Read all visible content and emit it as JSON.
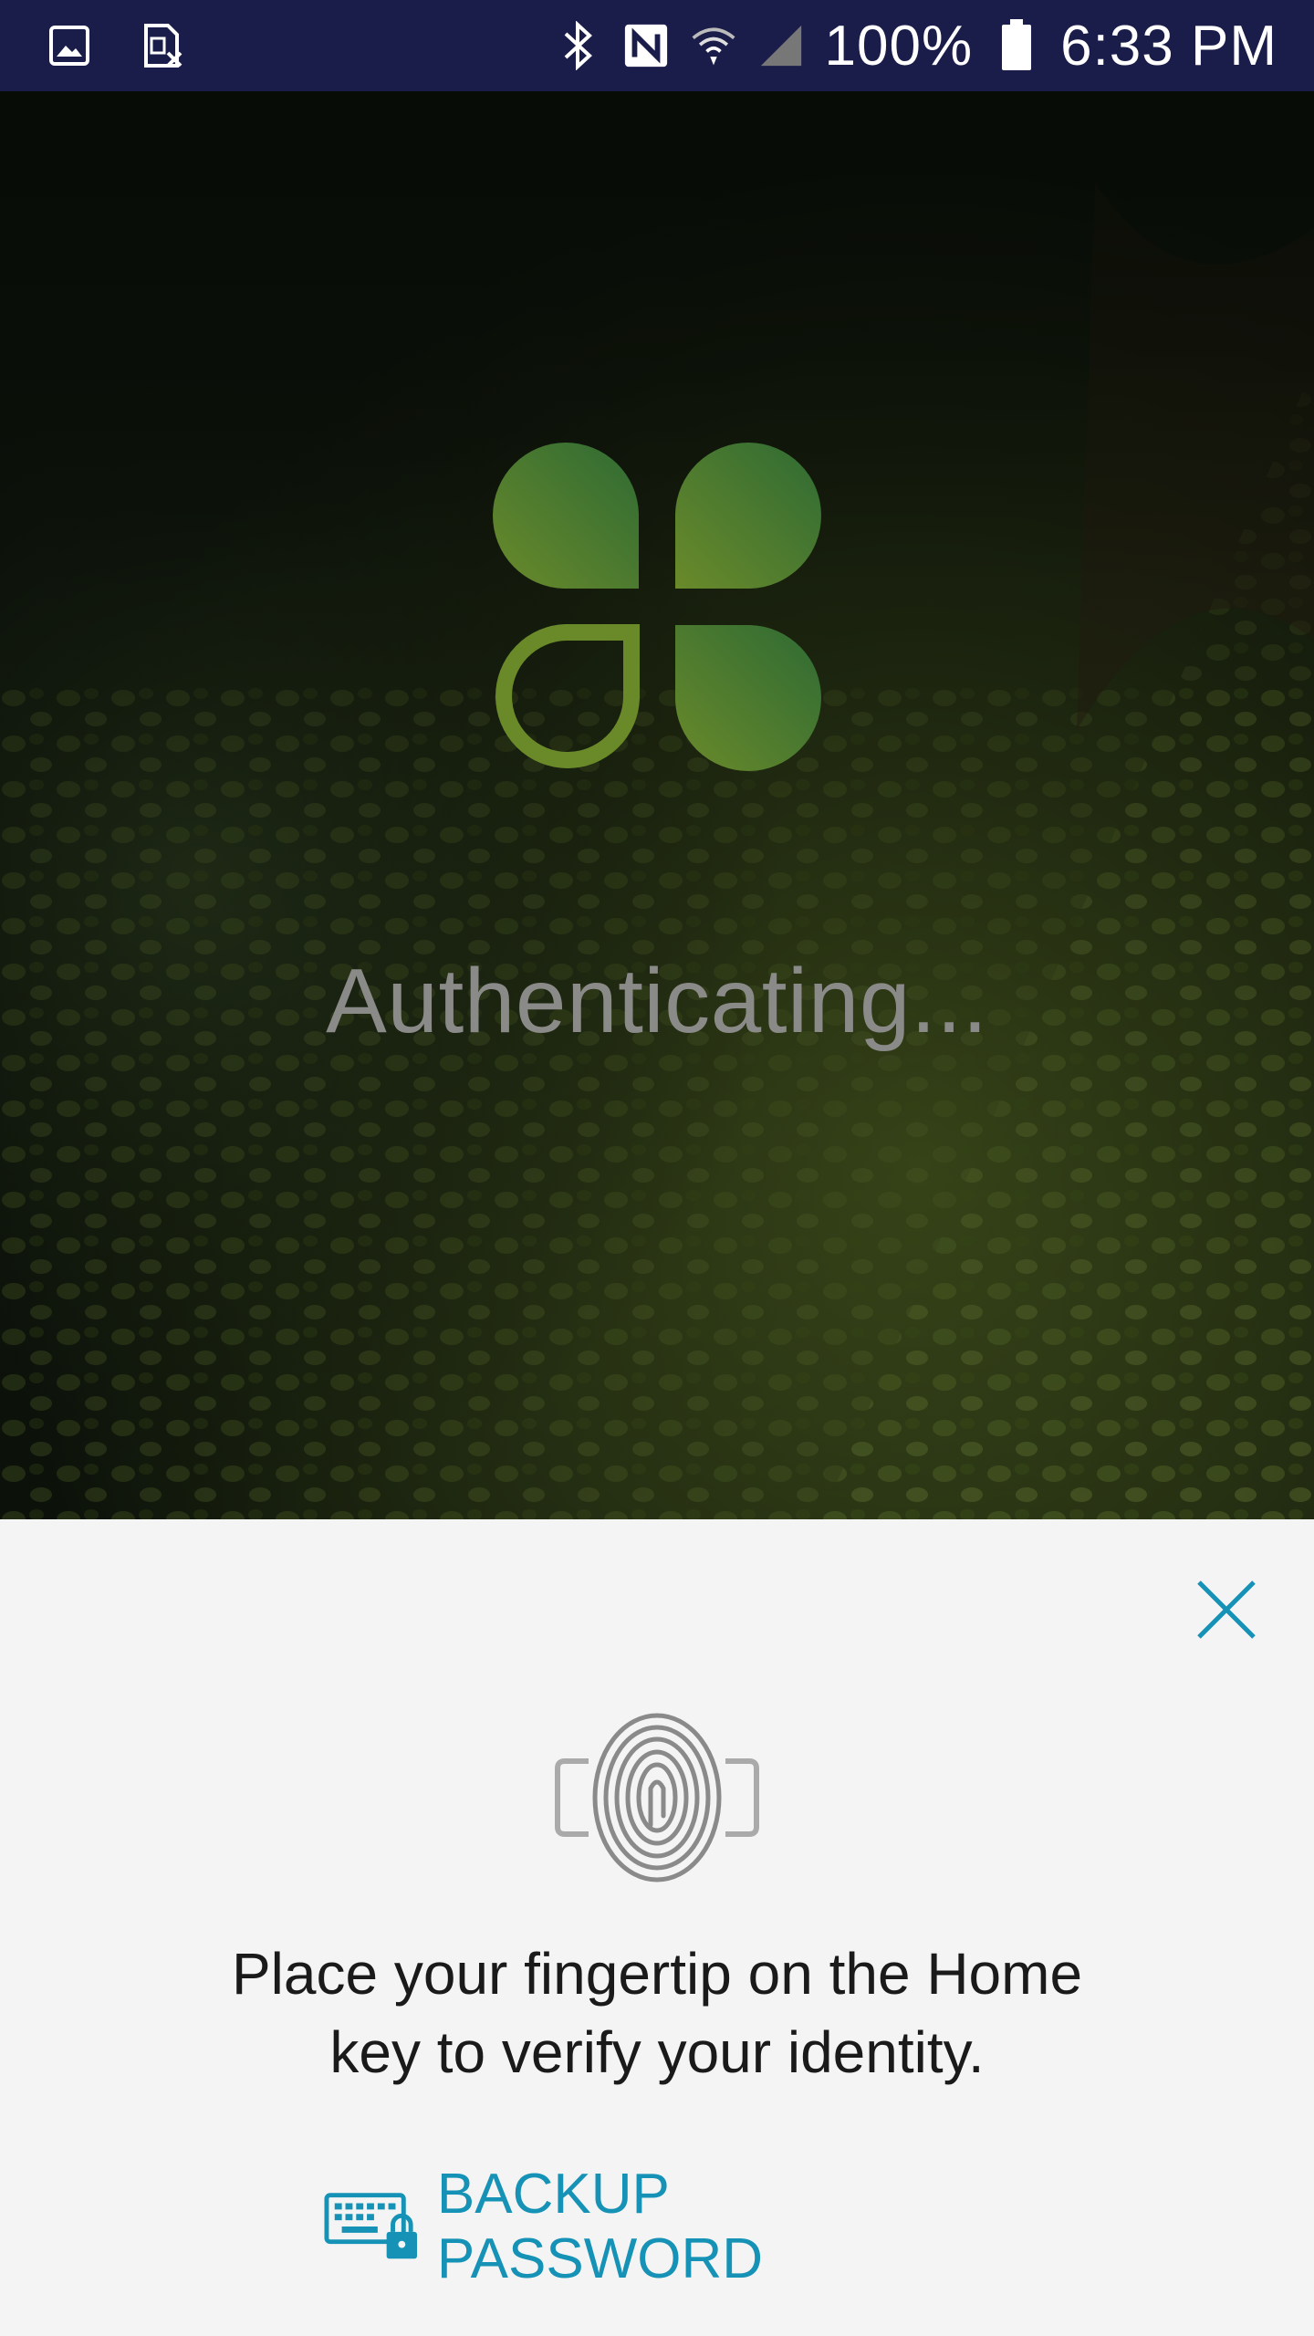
{
  "status_bar": {
    "battery": "100%",
    "time": "6:33 PM",
    "icons_left": [
      "gallery-icon",
      "sim-card-error-icon"
    ],
    "icons_right": [
      "bluetooth-icon",
      "nfc-icon",
      "wifi-icon",
      "signal-icon",
      "battery-icon"
    ],
    "background_color": "#1a1c4a"
  },
  "main": {
    "status_text": "Authenticating...",
    "logo": "clover-logo"
  },
  "fingerprint_dialog": {
    "prompt": "Place your fingertip on the Home key to verify your identity.",
    "prompt_line1": "Place your fingertip on the Home",
    "prompt_line2": "key to verify your identity.",
    "backup_label": "BACKUP PASSWORD",
    "accent_color": "#1592b5",
    "icons": [
      "close-icon",
      "fingerprint-icon",
      "keyboard-lock-icon"
    ]
  }
}
